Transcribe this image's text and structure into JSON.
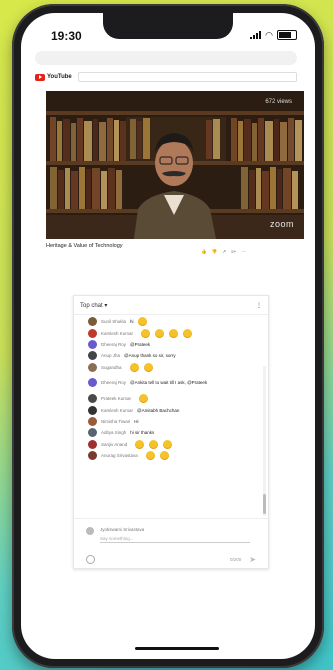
{
  "status": {
    "time": "19:30"
  },
  "youtube": {
    "logo": "YouTube"
  },
  "video": {
    "watermark": "zoom",
    "view_count": "672 views",
    "title": "Heritage & Value of Technology"
  },
  "chat": {
    "header": "Top chat",
    "messages": [
      {
        "name": "Sunil Shukla",
        "text": "hi",
        "emoji": 1,
        "color": "#7a5c3a"
      },
      {
        "name": "Kamlesh Kumar",
        "text": "",
        "emoji": 4,
        "color": "#c0392b"
      },
      {
        "name": "Dheeraj Roy",
        "text": "@Prateek",
        "emoji": 0,
        "color": "#6a5acd"
      },
      {
        "name": "Anup Jha",
        "text": "@Anup thank so sir, sorry",
        "emoji": 0,
        "color": "#444"
      },
      {
        "name": "Sugandha",
        "text": "",
        "emoji": 2,
        "color": "#8e6e53"
      },
      {
        "name": "Dheeraj Roy",
        "text": "@Ankita tell to wait till I ask, @Prateek",
        "emoji": 0,
        "color": "#6a5acd",
        "two_line": true
      },
      {
        "name": "Prateek Kumar",
        "text": "",
        "emoji": 1,
        "color": "#4a4a4a"
      },
      {
        "name": "Kamlesh Kumar",
        "text": "@Amitabh Bachchan",
        "emoji": 0,
        "color": "#333"
      },
      {
        "name": "Nimisha Tiwari",
        "text": "Hi",
        "emoji": 0,
        "color": "#9b5a3c"
      },
      {
        "name": "Aditya Singh",
        "text": "hi sir thanks",
        "emoji": 0,
        "color": "#5a6470"
      },
      {
        "name": "Sanjiv Anand",
        "text": "",
        "emoji": 3,
        "color": "#a03030"
      },
      {
        "name": "Anurag Srivastava",
        "text": "",
        "emoji": 2,
        "color": "#7a3b2e"
      }
    ],
    "me_name": "Jyotiswami Srivastava",
    "input_placeholder": "Say something...",
    "char_count": "0/200"
  }
}
